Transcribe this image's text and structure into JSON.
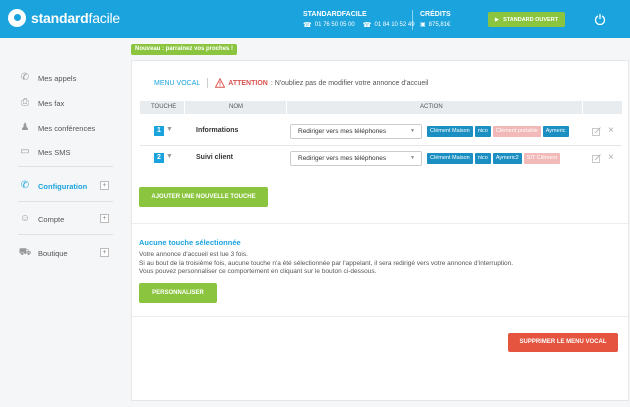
{
  "brand": {
    "name_bold": "standard",
    "name_light": "facile"
  },
  "header": {
    "standard_title": "STANDARDFACILE",
    "phone1": "01 76 50 05 00",
    "phone2": "01 84 10 52 49",
    "credits_title": "CRÉDITS",
    "credits_amount": "875,81€",
    "status_button": "STANDARD OUVERT"
  },
  "sidebar": {
    "items": [
      {
        "label": "Mes appels"
      },
      {
        "label": "Mes fax"
      },
      {
        "label": "Mes conférences"
      },
      {
        "label": "Mes SMS"
      },
      {
        "label": "Configuration"
      },
      {
        "label": "Compte"
      },
      {
        "label": "Boutique"
      }
    ],
    "plus": "+"
  },
  "banner": "Nouveau : parrainez vos proches !",
  "tabs": {
    "menu": "MENU VOCAL",
    "attention": "ATTENTION",
    "attention_text": ": N'oubliez pas de modifier votre annonce d'accueil"
  },
  "table": {
    "headers": {
      "key": "TOUCHE",
      "name": "NOM",
      "action": "ACTION"
    },
    "rows": [
      {
        "key": "1",
        "name": "Informations",
        "action": "Rediriger vers mes téléphones",
        "tags": [
          {
            "label": "Clément Maison",
            "state": "on"
          },
          {
            "label": "nico",
            "state": "on"
          },
          {
            "label": "Clément portable",
            "state": "off"
          },
          {
            "label": "Aymeric",
            "state": "on"
          }
        ]
      },
      {
        "key": "2",
        "name": "Suivi client",
        "action": "Rediriger vers mes téléphones",
        "tags": [
          {
            "label": "Clément Maison",
            "state": "on"
          },
          {
            "label": "nico",
            "state": "on"
          },
          {
            "label": "Aymeric2",
            "state": "on"
          },
          {
            "label": "SIT Clément",
            "state": "off"
          }
        ]
      }
    ]
  },
  "add_button": "AJOUTER UNE NOUVELLE TOUCHE",
  "section": {
    "title": "Aucune touche sélectionnée",
    "line1": "Votre annonce d'accueil est lue 3 fois.",
    "line2": "Si au bout de la troisième fois, aucune touche n'a été sélectionnée par l'appelant, il sera redirigé vers votre annonce d'interruption.",
    "line3": "Vous pouvez personnaliser ce comportement en cliquant sur le bouton ci-dessous."
  },
  "customize_button": "PERSONNALISER",
  "delete_button": "SUPPRIMER LE MENU VOCAL",
  "colors": {
    "primary": "#1ba3dd",
    "green": "#8bc53f",
    "red": "#e4543f",
    "tag_blue": "#1b8fc2",
    "tag_off": "#f1b9b8"
  }
}
